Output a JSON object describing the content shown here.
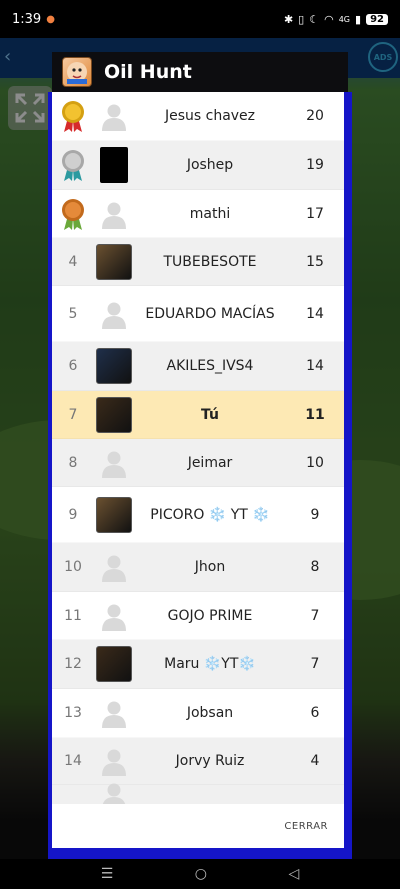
{
  "status_bar": {
    "time": "1:39",
    "network": "4G",
    "battery": "92"
  },
  "dialog": {
    "title": "Oil Hunt",
    "close_label": "CERRAR"
  },
  "leaderboard": [
    {
      "rank": "",
      "medal": "gold",
      "avatar": "default",
      "name": "Jesus chavez",
      "score": "20"
    },
    {
      "rank": "",
      "medal": "silver",
      "avatar": "black",
      "name": "Joshep",
      "score": "19"
    },
    {
      "rank": "",
      "medal": "bronze",
      "avatar": "default",
      "name": "mathi",
      "score": "17"
    },
    {
      "rank": "4",
      "medal": "",
      "avatar": "photo",
      "name": "TUBEBESOTE",
      "score": "15"
    },
    {
      "rank": "5",
      "medal": "",
      "avatar": "default",
      "name": "EDUARDO MACÍAS",
      "score": "14"
    },
    {
      "rank": "6",
      "medal": "",
      "avatar": "photo",
      "name": "AKILES_IVS4",
      "score": "14"
    },
    {
      "rank": "7",
      "medal": "",
      "avatar": "photo",
      "name": "Tú",
      "score": "11",
      "is_self": true
    },
    {
      "rank": "8",
      "medal": "",
      "avatar": "default",
      "name": "Jeimar",
      "score": "10"
    },
    {
      "rank": "9",
      "medal": "",
      "avatar": "photo",
      "name": "PICORO ❄️ YT ❄️",
      "score": "9"
    },
    {
      "rank": "10",
      "medal": "",
      "avatar": "default",
      "name": "Jhon",
      "score": "8"
    },
    {
      "rank": "11",
      "medal": "",
      "avatar": "default",
      "name": "GOJO PRIME",
      "score": "7"
    },
    {
      "rank": "12",
      "medal": "",
      "avatar": "photo",
      "name": "Maru ❄️YT❄️",
      "score": "7"
    },
    {
      "rank": "13",
      "medal": "",
      "avatar": "default",
      "name": "Jobsan",
      "score": "6"
    },
    {
      "rank": "14",
      "medal": "",
      "avatar": "default",
      "name": "Jorvy Ruiz",
      "score": "4"
    }
  ],
  "colors": {
    "self_row": "#fde9b4",
    "alt_row": "#f0f0f0",
    "frame": "#1515c8",
    "header": "#0d0d10"
  }
}
